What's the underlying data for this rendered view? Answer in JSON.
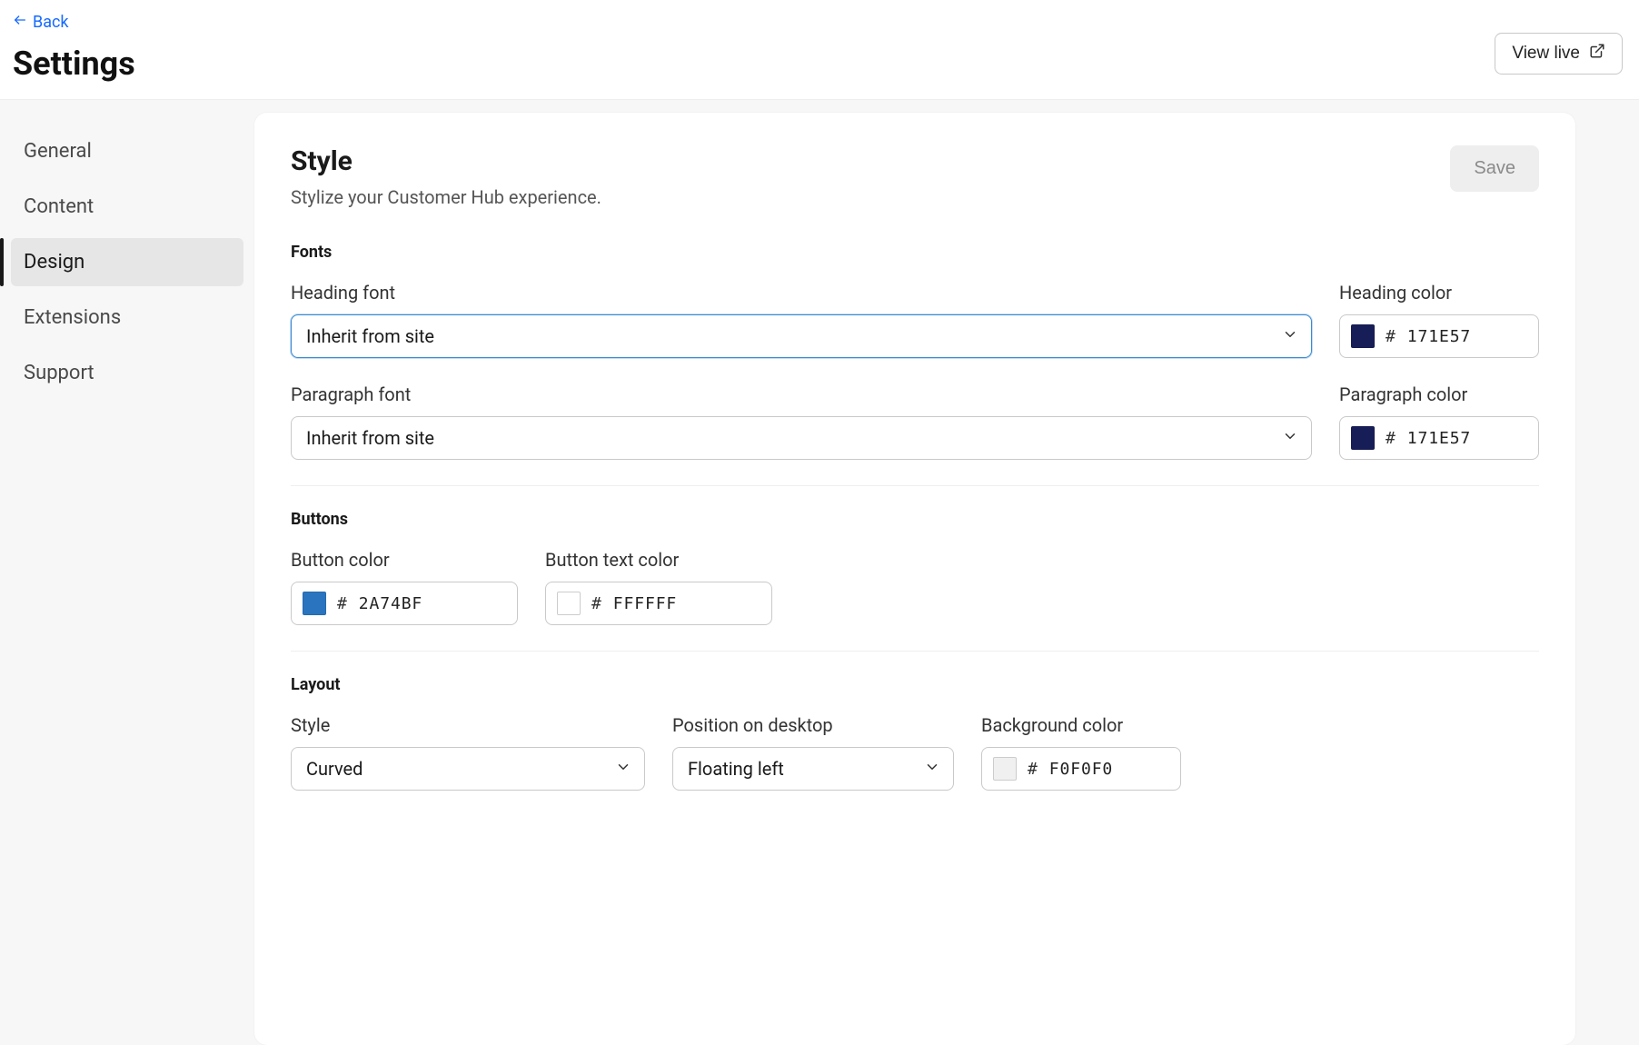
{
  "header": {
    "back_label": "Back",
    "title": "Settings",
    "view_live_label": "View live"
  },
  "sidebar": {
    "items": [
      {
        "label": "General",
        "active": false
      },
      {
        "label": "Content",
        "active": false
      },
      {
        "label": "Design",
        "active": true
      },
      {
        "label": "Extensions",
        "active": false
      },
      {
        "label": "Support",
        "active": false
      }
    ]
  },
  "card": {
    "title": "Style",
    "subtitle": "Stylize your Customer Hub experience.",
    "save_label": "Save"
  },
  "fonts_section": {
    "title": "Fonts",
    "heading_font_label": "Heading font",
    "heading_font_value": "Inherit from site",
    "heading_color_label": "Heading color",
    "heading_color_hex": "171E57",
    "paragraph_font_label": "Paragraph font",
    "paragraph_font_value": "Inherit from site",
    "paragraph_color_label": "Paragraph color",
    "paragraph_color_hex": "171E57"
  },
  "buttons_section": {
    "title": "Buttons",
    "button_color_label": "Button color",
    "button_color_hex": "2A74BF",
    "button_text_color_label": "Button text color",
    "button_text_color_hex": "FFFFFF"
  },
  "layout_section": {
    "title": "Layout",
    "style_label": "Style",
    "style_value": "Curved",
    "position_label": "Position on desktop",
    "position_value": "Floating left",
    "bg_color_label": "Background color",
    "bg_color_hex": "F0F0F0"
  }
}
